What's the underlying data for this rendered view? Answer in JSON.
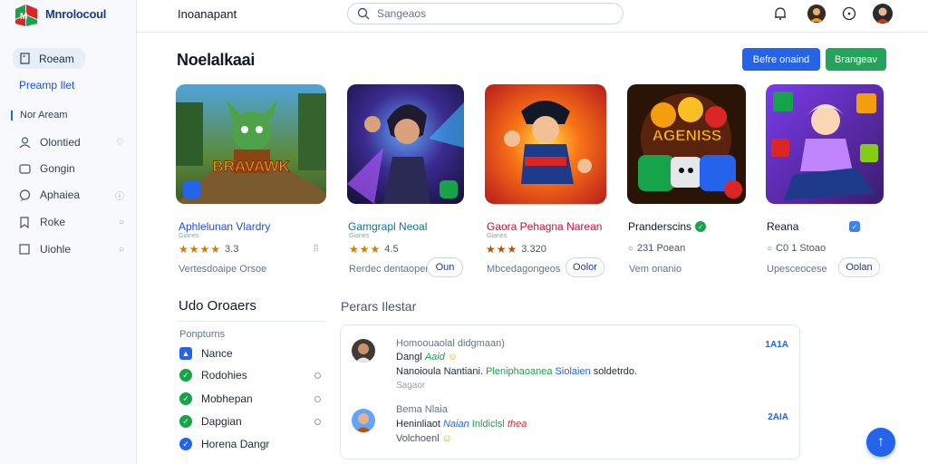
{
  "brand": {
    "name": "Mnrolocoul",
    "tagline": ""
  },
  "sidebar": {
    "active_item": "Roeam",
    "link_item": "Preamp Ilet",
    "section_label": "Nor Aream",
    "items": [
      {
        "label": "Olontied",
        "icon": "heart-icon"
      },
      {
        "label": "Gongin",
        "icon": "folder-icon"
      },
      {
        "label": "Aphaiea",
        "icon": "chat-icon"
      },
      {
        "label": "Roke",
        "icon": "bookmark-icon"
      },
      {
        "label": "Uiohle",
        "icon": "square-icon"
      }
    ]
  },
  "header": {
    "title": "Inoanapant",
    "search_placeholder": "Sangeaos"
  },
  "main": {
    "title": "Noelalkaai",
    "primary_button": "Befre onaind",
    "secondary_button": "Brangeav"
  },
  "cards": [
    {
      "title": "Aphlelunan Vlardry",
      "subtitle": "Gianes",
      "stars": "★★★★",
      "rating": "3.3",
      "meta": "Vertesdoaipe   Orsoe",
      "title_color": "#1d4ed8",
      "badge": "",
      "badge_color": "#2563eb",
      "thumb_text": "BRAVAWK"
    },
    {
      "title": "Gamgrapl Neoal",
      "subtitle": "Gianes",
      "stars": "★★★",
      "rating": "4.5",
      "meta": "Rerdec dentaoper",
      "button": "Oun",
      "title_color": "#0e7490",
      "badge": "",
      "badge_color": "#16a34a",
      "thumb_text": ""
    },
    {
      "title": "Gaora Pehagna Narean",
      "subtitle": "Gianes",
      "stars": "★★★",
      "rating": "3.320",
      "meta": "Mbcedagongeos",
      "button": "Oolor",
      "title_color": "#be123c",
      "badge": "",
      "badge_color": "",
      "thumb_text": ""
    },
    {
      "title": "Pranderscins",
      "subtitle": "",
      "stars": "",
      "rating": "231 Poean",
      "meta": "Vem onanio",
      "title_color": "#111827",
      "badge": "",
      "badge_color": "#dc2626",
      "thumb_text": "AGENISS"
    },
    {
      "title": "Reana",
      "subtitle": "",
      "stars": "",
      "rating": "C0 1 Stoao",
      "meta": "Upesceocese",
      "button": "Oolan",
      "title_color": "#111827",
      "badge": "",
      "badge_color": "",
      "thumb_text": ""
    }
  ],
  "tasks_panel": {
    "title": "Udo Oroaers",
    "subtitle": "Ponpturns",
    "items": [
      {
        "label": "Nance",
        "color": "#2563eb"
      },
      {
        "label": "Rodohies",
        "color": "#16a34a"
      },
      {
        "label": "Mobhepan",
        "color": "#16a34a"
      },
      {
        "label": "Dapgian",
        "color": "#16a34a"
      },
      {
        "label": "Horena Dangr",
        "color": "#2563eb"
      }
    ]
  },
  "activity": {
    "title": "Perars Ilestar",
    "entries": [
      {
        "line1": "Homoouaolal didgmaan)",
        "line2_a": "Dangl",
        "line2_b": "Aaid",
        "line3_a": "Nanoioula Nantiani.",
        "line3_b": "Pleniphaoanea",
        "line3_c": "Siolaien",
        "line3_d": "soldetrdo.",
        "line4": "Sagaor",
        "time": "1A1A"
      },
      {
        "line1": "Bema Nlaia",
        "line2_a": "Heninliaot",
        "line2_b": "Naian",
        "line2_c": "Inldiclsl",
        "line2_d": "thea",
        "line3_a": "Volchoenl",
        "time": "2AIA"
      }
    ]
  }
}
